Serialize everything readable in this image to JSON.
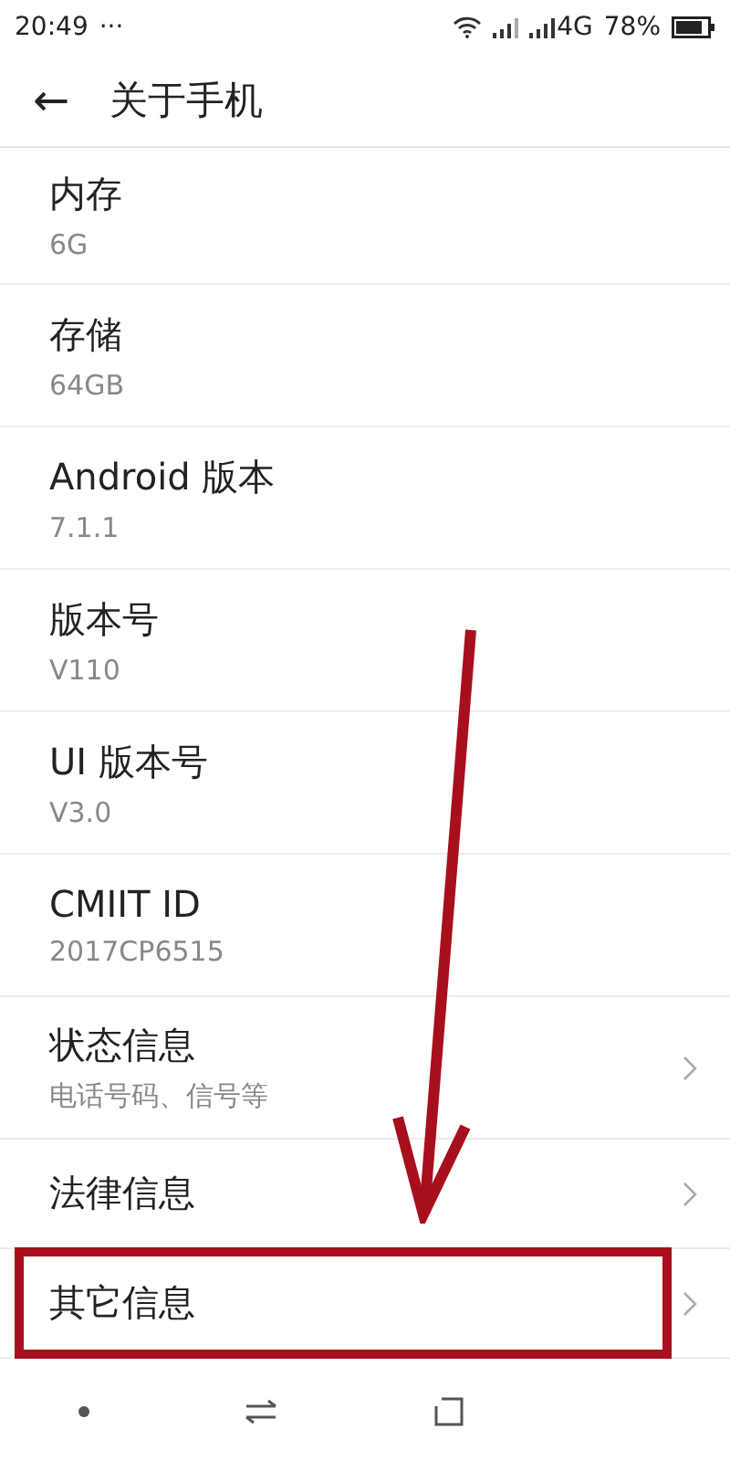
{
  "status_bar": {
    "time": "20:49",
    "more": "···",
    "network": "4G",
    "battery": "78%"
  },
  "header": {
    "back": "←",
    "title": "关于手机"
  },
  "items": [
    {
      "title": "内存",
      "subtitle": "6G",
      "chevron": false,
      "highlighted": false
    },
    {
      "title": "存储",
      "subtitle": "64GB",
      "chevron": false,
      "highlighted": false
    },
    {
      "title": "Android 版本",
      "subtitle": "7.1.1",
      "chevron": false,
      "highlighted": false
    },
    {
      "title": "版本号",
      "subtitle": "V110",
      "chevron": false,
      "highlighted": false
    },
    {
      "title": "UI 版本号",
      "subtitle": "V3.0",
      "chevron": false,
      "highlighted": false
    },
    {
      "title": "CMIIT ID",
      "subtitle": "2017CP6515",
      "chevron": false,
      "highlighted": false
    },
    {
      "title": "状态信息",
      "subtitle": "电话号码、信号等",
      "chevron": true,
      "highlighted": false
    },
    {
      "title": "法律信息",
      "chevron": true,
      "highlighted": false
    },
    {
      "title": "其它信息",
      "chevron": true,
      "highlighted": true
    }
  ],
  "annotation": {
    "arrow": true
  }
}
